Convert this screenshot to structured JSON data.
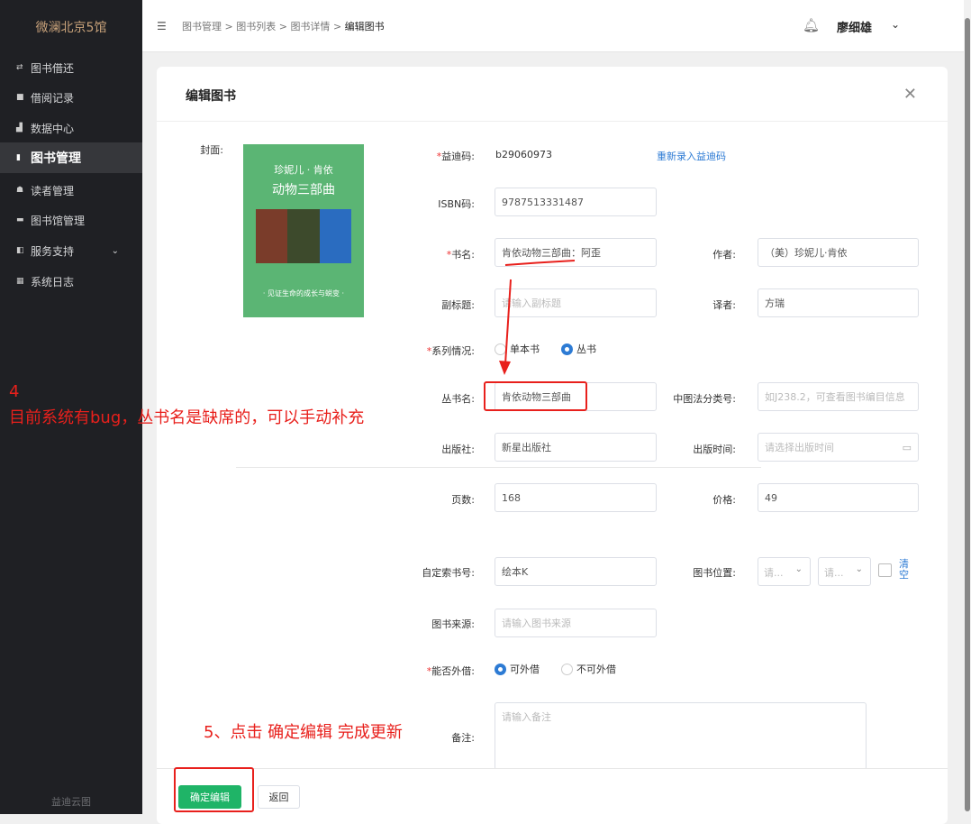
{
  "sidebar": {
    "brand": "微澜北京5馆",
    "items": [
      {
        "label": "图书借还",
        "icon": "swap-icon"
      },
      {
        "label": "借阅记录",
        "icon": "edit-icon"
      },
      {
        "label": "数据中心",
        "icon": "bar-chart-icon"
      },
      {
        "label": "图书管理",
        "icon": "book-icon",
        "active": true
      },
      {
        "label": "读者管理",
        "icon": "users-icon"
      },
      {
        "label": "图书馆管理",
        "icon": "library-icon"
      },
      {
        "label": "服务支持",
        "icon": "service-icon"
      },
      {
        "label": "系统日志",
        "icon": "grid-icon"
      }
    ],
    "footer": "益迪云图"
  },
  "header": {
    "breadcrumb": [
      "图书管理",
      "图书列表",
      "图书详情",
      "编辑图书"
    ],
    "separator": ">",
    "user": "廖细雄"
  },
  "dialog": {
    "title": "编辑图书",
    "cover_label": "封面:",
    "cover": {
      "line1": "珍妮儿 · 肯依",
      "line2": "动物三部曲",
      "line3": "· 见证生命的成长与蜕变 ·"
    },
    "fields": {
      "barcode": {
        "label": "益迪码:",
        "value": "b29060973",
        "action": "重新录入益迪码"
      },
      "isbn": {
        "label": "ISBN码:",
        "value": "9787513331487"
      },
      "title": {
        "label": "书名:",
        "value": "肯依动物三部曲：阿歪"
      },
      "author": {
        "label": "作者:",
        "value": "（美）珍妮儿·肯依"
      },
      "subtitle": {
        "label": "副标题:",
        "placeholder": "请输入副标题"
      },
      "translator": {
        "label": "译者:",
        "value": "方瑞"
      },
      "series": {
        "label": "系列情况:",
        "options": [
          "单本书",
          "丛书"
        ],
        "selected": "丛书"
      },
      "series_name": {
        "label": "丛书名:",
        "value": "肯依动物三部曲"
      },
      "clc": {
        "label": "中图法分类号:",
        "placeholder": "如J238.2，可查看图书编目信息"
      },
      "publisher": {
        "label": "出版社:",
        "value": "新星出版社"
      },
      "pub_date": {
        "label": "出版时间:",
        "placeholder": "请选择出版时间"
      },
      "pages": {
        "label": "页数:",
        "value": "168"
      },
      "price": {
        "label": "价格:",
        "value": "49"
      },
      "call_no": {
        "label": "自定索书号:",
        "value": "绘本K"
      },
      "location": {
        "label": "图书位置:",
        "placeholder1": "请...",
        "placeholder2": "请...",
        "clear": "清空"
      },
      "source": {
        "label": "图书来源:",
        "placeholder": "请输入图书来源"
      },
      "lendable": {
        "label": "能否外借:",
        "options": [
          "可外借",
          "不可外借"
        ],
        "selected": "可外借"
      },
      "remarks": {
        "label": "备注:",
        "placeholder": "请输入备注"
      }
    },
    "buttons": {
      "confirm": "确定编辑",
      "back": "返回"
    }
  },
  "annotations": {
    "step4_num": "4",
    "step4_text": "目前系统有bug，丛书名是缺席的，可以手动补充",
    "step5_text": "5、点击 确定编辑 完成更新"
  }
}
